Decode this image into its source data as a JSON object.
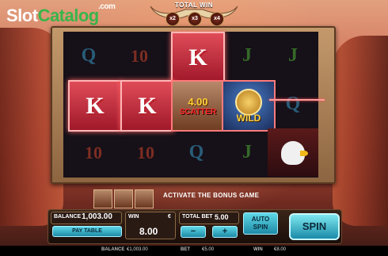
{
  "logo": {
    "slot": "Slot",
    "catalog": "Catalog",
    "com": ".com"
  },
  "header": {
    "total_win_label": "TOTAL WIN",
    "multipliers": [
      "x2",
      "x3",
      "x4"
    ]
  },
  "reels": {
    "row1": [
      "Q",
      "10",
      "K",
      "J",
      "J"
    ],
    "row2": [
      "K",
      "K",
      "SCATTER",
      "WILD",
      "Q"
    ],
    "row3": [
      "10",
      "10",
      "Q",
      "J",
      "EAGLE"
    ],
    "scatter_amount": "4.00",
    "scatter_label": "SCATTER",
    "wild_label": "WILD"
  },
  "bonus": {
    "text": "ACTIVATE THE BONUS GAME"
  },
  "panel": {
    "balance_label": "BALANCE",
    "balance_value": "1,003.00",
    "paytable_label": "PAY TABLE",
    "win_label": "WIN",
    "win_currency": "€",
    "win_value": "8.00",
    "total_bet_label": "TOTAL BET",
    "total_bet_value": "5.00",
    "minus_label": "−",
    "plus_label": "+",
    "auto_label": "AUTO",
    "auto_sub": "SPIN",
    "spin_label": "SPIN"
  },
  "footer": {
    "balance_label": "BALANCE",
    "balance_value": "€1,003.00",
    "bet_label": "BET",
    "bet_value": "€5.00",
    "win_label": "WIN",
    "win_value": "€8.00"
  },
  "colors": {
    "logo_green": "#39b54a",
    "spin_button": "#5fd8e8",
    "scatter_red": "#ff2a2a",
    "wild_gold": "#ffd23a"
  },
  "icons": [
    "bull-horns-icon",
    "gold-bison-coin-icon",
    "eagle-icon"
  ]
}
